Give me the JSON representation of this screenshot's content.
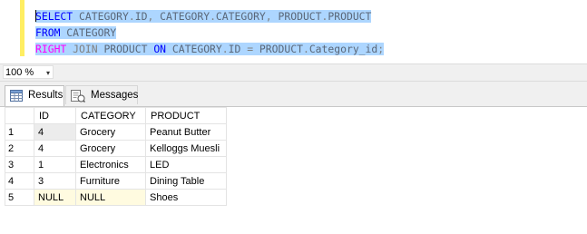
{
  "editor": {
    "lines": [
      [
        {
          "t": "SELECT",
          "c": "kw"
        },
        {
          "t": " CATEGORY",
          "c": "id"
        },
        {
          "t": ".",
          "c": "op"
        },
        {
          "t": "ID",
          "c": "id"
        },
        {
          "t": ",",
          "c": "op"
        },
        {
          "t": " CATEGORY",
          "c": "id"
        },
        {
          "t": ".",
          "c": "op"
        },
        {
          "t": "CATEGORY",
          "c": "id"
        },
        {
          "t": ",",
          "c": "op"
        },
        {
          "t": " PRODUCT",
          "c": "id"
        },
        {
          "t": ".",
          "c": "op"
        },
        {
          "t": "PRODUCT",
          "c": "id"
        }
      ],
      [
        {
          "t": "FROM",
          "c": "kw"
        },
        {
          "t": " CATEGORY",
          "c": "id"
        }
      ],
      [
        {
          "t": "RIGHT",
          "c": "fn"
        },
        {
          "t": " ",
          "c": "id"
        },
        {
          "t": "JOIN",
          "c": "op"
        },
        {
          "t": " PRODUCT ",
          "c": "id"
        },
        {
          "t": "ON",
          "c": "kw"
        },
        {
          "t": " CATEGORY",
          "c": "id"
        },
        {
          "t": ".",
          "c": "op"
        },
        {
          "t": "ID ",
          "c": "id"
        },
        {
          "t": "=",
          "c": "op"
        },
        {
          "t": " PRODUCT",
          "c": "id"
        },
        {
          "t": ".",
          "c": "op"
        },
        {
          "t": "Category_id",
          "c": "id"
        },
        {
          "t": ";",
          "c": "op"
        }
      ]
    ]
  },
  "zoom": {
    "value": "100 %",
    "dropdown_glyph": "▾"
  },
  "tabs": {
    "results_label": "Results",
    "messages_label": "Messages"
  },
  "results": {
    "columns": [
      "",
      "ID",
      "CATEGORY",
      "PRODUCT"
    ],
    "rows": [
      [
        "1",
        "4",
        "Grocery",
        "Peanut Butter"
      ],
      [
        "2",
        "4",
        "Grocery",
        "Kelloggs Muesli"
      ],
      [
        "3",
        "1",
        "Electronics",
        "LED"
      ],
      [
        "4",
        "3",
        "Furniture",
        "Dining Table"
      ],
      [
        "5",
        "NULL",
        "NULL",
        "Shoes"
      ]
    ]
  },
  "colors": {
    "selection": "#add6ff",
    "keyword": "#0000ff",
    "function_keyword": "#ff00ff",
    "identifier": "#5a6778",
    "gutter_marker": "#ffee62",
    "null_cell": "#fffbe0"
  }
}
